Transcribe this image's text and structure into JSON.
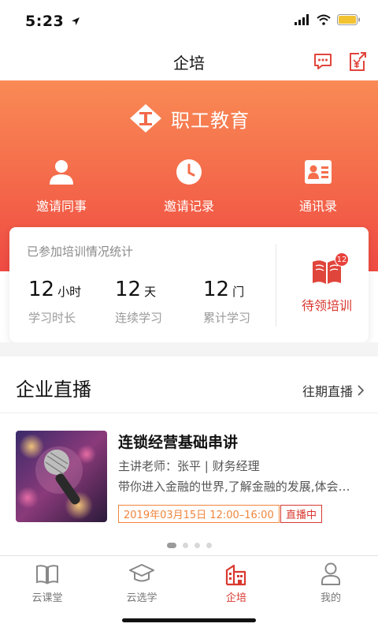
{
  "status": {
    "time": "5:23"
  },
  "nav": {
    "title": "企培"
  },
  "brand": {
    "name": "职工教育"
  },
  "quick_actions": [
    {
      "label": "邀请同事",
      "icon": "person-icon"
    },
    {
      "label": "邀请记录",
      "icon": "clock-icon"
    },
    {
      "label": "通讯录",
      "icon": "contact-card-icon"
    }
  ],
  "stats": {
    "title": "已参加培训情况统计",
    "items": [
      {
        "value": "12",
        "unit": "小时",
        "label": "学习时长"
      },
      {
        "value": "12",
        "unit": "天",
        "label": "连续学习"
      },
      {
        "value": "12",
        "unit": "门",
        "label": "累计学习"
      }
    ],
    "pending": {
      "label": "待领培训",
      "badge": "12"
    }
  },
  "live": {
    "title": "企业直播",
    "more": "往期直播",
    "item": {
      "title": "连锁经营基础串讲",
      "teacher": "主讲老师：张平 | 财务经理",
      "desc": "带你进入金融的世界,了解金融的发展,体会…",
      "date": "2019年03月15日 12:00–16:00",
      "status": "直播中"
    }
  },
  "tabs": [
    {
      "label": "云课堂",
      "icon": "book-icon",
      "active": false
    },
    {
      "label": "云选学",
      "icon": "graduation-cap-icon",
      "active": false
    },
    {
      "label": "企培",
      "icon": "building-icon",
      "active": true
    },
    {
      "label": "我的",
      "icon": "user-icon",
      "active": false
    }
  ],
  "colors": {
    "accent": "#d9382f",
    "hero_top": "#f98a55",
    "hero_bottom": "#ef4a42",
    "date_tag": "#f0853c"
  }
}
